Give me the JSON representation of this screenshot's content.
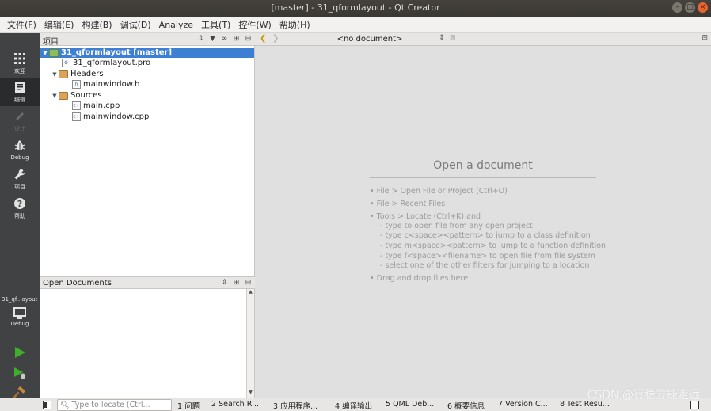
{
  "window": {
    "title": "[master] - 31_qformlayout - Qt Creator"
  },
  "menu": [
    "文件(F)",
    "编辑(E)",
    "构建(B)",
    "调试(D)",
    "Analyze",
    "工具(T)",
    "控件(W)",
    "帮助(H)"
  ],
  "modes": [
    {
      "label": "欢迎",
      "icon": "grid-icon"
    },
    {
      "label": "编辑",
      "icon": "edit-document-icon"
    },
    {
      "label": "设计",
      "icon": "pencil-icon"
    },
    {
      "label": "Debug",
      "icon": "bug-icon"
    },
    {
      "label": "项目",
      "icon": "wrench-icon"
    },
    {
      "label": "帮助",
      "icon": "help-icon"
    }
  ],
  "kit": {
    "project": "31_qf...ayout",
    "target": "Debug"
  },
  "project_pane": {
    "title": "项目",
    "tree": [
      {
        "label": "31_qformlayout [master]"
      },
      {
        "label": "31_qformlayout.pro"
      },
      {
        "label": "Headers"
      },
      {
        "label": "mainwindow.h"
      },
      {
        "label": "Sources"
      },
      {
        "label": "main.cpp"
      },
      {
        "label": "mainwindow.cpp"
      }
    ]
  },
  "open_documents": {
    "title": "Open Documents"
  },
  "editor": {
    "current_doc": "<no document>",
    "heading": "Open a document",
    "hints": [
      "• File > Open File or Project (Ctrl+O)",
      "• File > Recent Files",
      "• Tools > Locate (Ctrl+K) and",
      "- type to open file from any open project",
      "- type c<space><pattern> to jump to a class definition",
      "- type m<space><pattern> to jump to a function definition",
      "- type f<space><filename> to open file from file system",
      "- select one of the other filters for jumping to a location",
      "• Drag and drop files here"
    ]
  },
  "statusbar": {
    "locator_placeholder": "Type to locate (Ctrl...",
    "tabs": [
      "1 问题",
      "2 Search R...",
      "3 应用程序...",
      "4 编译输出",
      "5 QML Deb...",
      "6 概要信息",
      "7 Version C...",
      "8 Test Resu..."
    ]
  },
  "watermark": "CSDN @行稳方能走远",
  "colors": {
    "selection": "#3d7fd2",
    "modebar": "#404244",
    "run_green": "#3fae2a"
  }
}
